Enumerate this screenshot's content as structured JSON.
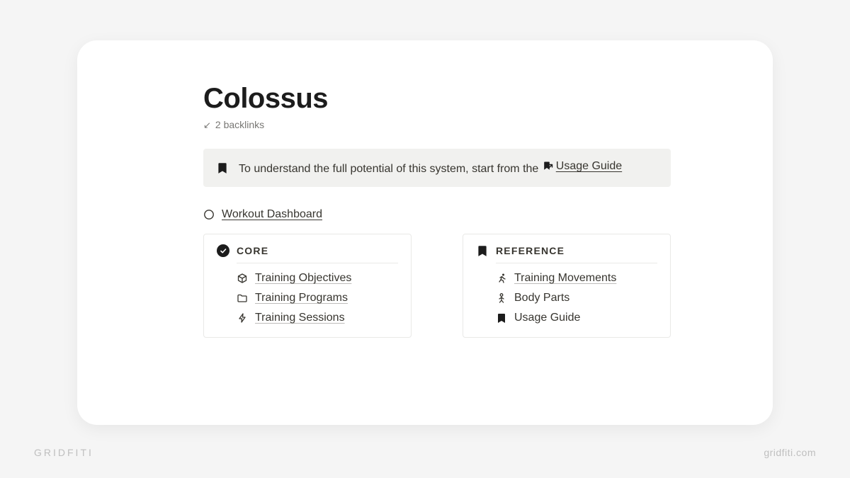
{
  "page": {
    "title": "Colossus",
    "backlinks_label": "2 backlinks"
  },
  "callout": {
    "text": "To understand the full potential of this system, start from the ",
    "link_label": "Usage Guide"
  },
  "dashboard": {
    "label": "Workout Dashboard"
  },
  "columns": {
    "core": {
      "heading": "CORE",
      "items": [
        {
          "id": "training-objectives",
          "label": "Training Objectives",
          "icon": "cube"
        },
        {
          "id": "training-programs",
          "label": "Training Programs",
          "icon": "folder"
        },
        {
          "id": "training-sessions",
          "label": "Training Sessions",
          "icon": "bolt"
        }
      ]
    },
    "reference": {
      "heading": "REFERENCE",
      "items": [
        {
          "id": "training-movements",
          "label": "Training Movements",
          "icon": "runner"
        },
        {
          "id": "body-parts",
          "label": "Body Parts",
          "icon": "person",
          "plain": true
        },
        {
          "id": "usage-guide",
          "label": "Usage Guide",
          "icon": "bookmark-solid",
          "plain": true
        }
      ]
    }
  },
  "watermark": {
    "left": "GRIDFITI",
    "right": "gridfiti.com"
  }
}
